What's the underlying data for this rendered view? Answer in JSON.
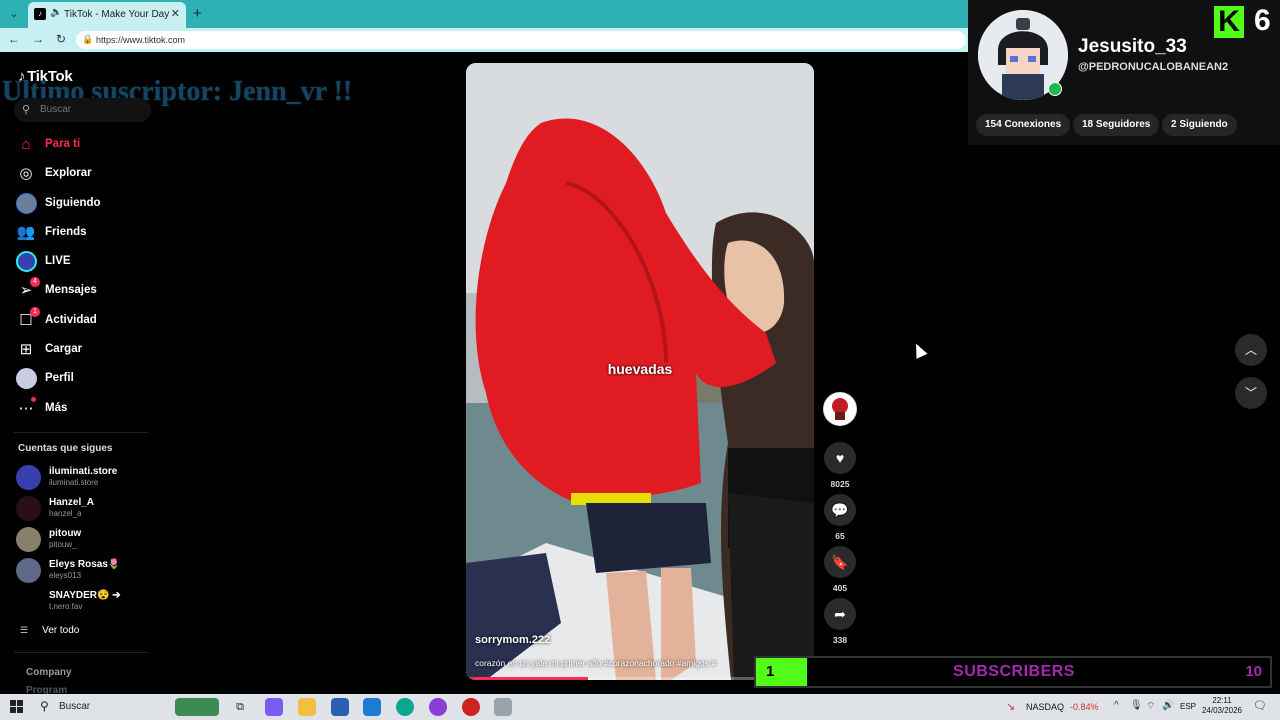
{
  "browser": {
    "tab_title": "TikTok - Make Your Day",
    "url": "https://www.tiktok.com"
  },
  "overlay_text": "Ultimo suscriptor: Jenn_vr !!",
  "sidebar": {
    "logo": "TikTok",
    "search_placeholder": "Buscar",
    "nav": [
      {
        "label": "Para ti",
        "icon": "home-icon",
        "active": true
      },
      {
        "label": "Explorar",
        "icon": "compass-icon"
      },
      {
        "label": "Siguiendo",
        "icon": "following-avatar-icon"
      },
      {
        "label": "Friends",
        "icon": "friends-icon"
      },
      {
        "label": "LIVE",
        "icon": "live-icon"
      },
      {
        "label": "Mensajes",
        "icon": "messages-icon",
        "badge": "4"
      },
      {
        "label": "Actividad",
        "icon": "activity-icon",
        "badge": "1"
      },
      {
        "label": "Cargar",
        "icon": "upload-icon"
      },
      {
        "label": "Perfil",
        "icon": "profile-avatar-icon"
      },
      {
        "label": "Más",
        "icon": "more-icon",
        "dot": true
      }
    ],
    "following_title": "Cuentas que sigues",
    "accounts": [
      {
        "name": "iluminati.store",
        "handle": "iluminati.store",
        "color": "#3a3fb0"
      },
      {
        "name": "Hanzel_A",
        "handle": "hanzel_a",
        "color": "#2a1016"
      },
      {
        "name": "pitouw",
        "handle": "pitouw_",
        "color": "#8a7f6a"
      },
      {
        "name": "Eleys Rosas🌷",
        "handle": "eleys013",
        "color": "#5f6a8a"
      },
      {
        "name": "SNAYDER😵 ➔",
        "handle": "t.nero.fav",
        "color": "#000000"
      }
    ],
    "see_all": "Ver todo",
    "footer": [
      "Company",
      "Program"
    ]
  },
  "video": {
    "caption": "huevadas",
    "username": "sorrymom.222",
    "description": "corazón en un yate mi primer año #corazonachorado #amigos #",
    "progress": 0.35
  },
  "actions": [
    {
      "icon": "heart-icon",
      "count": "8025"
    },
    {
      "icon": "comment-icon",
      "count": "65"
    },
    {
      "icon": "bookmark-icon",
      "count": "405"
    },
    {
      "icon": "share-icon",
      "count": "338"
    }
  ],
  "streamer": {
    "name": "Jesusito_33",
    "handle": "@PEDRONUCALOBANEAN2",
    "stats": [
      "154 Conexiones",
      "18 Seguidores",
      "2 Siguiendo"
    ],
    "kick_letter": "K",
    "kick_number": "6"
  },
  "subscribers": {
    "current": "1",
    "label": "SUBSCRIBERS",
    "goal": "10",
    "progress": 0.1
  },
  "taskbar": {
    "search": "Buscar",
    "stock_name": "NASDAQ",
    "stock_change": "-0.84%",
    "lang": "ESP",
    "time": "22:11",
    "date": "24/03/2026"
  },
  "colors": {
    "accent": "#fe2c55",
    "kick_green": "#53fc18",
    "subs_purple": "#a429b0",
    "chrome_teal": "#2fb0b3"
  }
}
